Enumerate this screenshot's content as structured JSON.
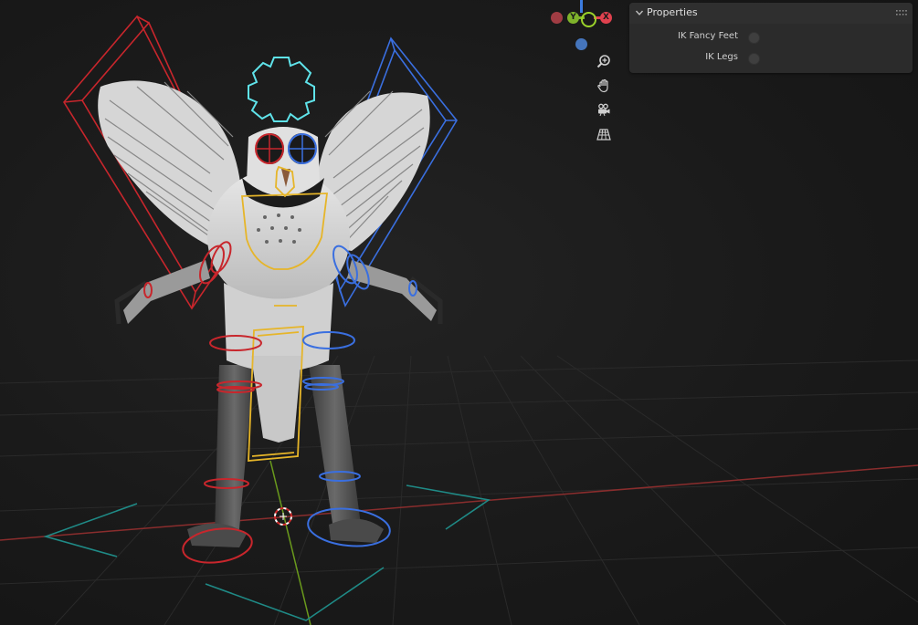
{
  "gizmo": {
    "x_label": "X",
    "y_label": "Y",
    "colors": {
      "x": "#e0414e",
      "y": "#7fb32b",
      "z": "#4a7fce"
    }
  },
  "nav_tools": [
    {
      "icon": "zoom-icon"
    },
    {
      "icon": "hand-pan-icon"
    },
    {
      "icon": "camera-icon"
    },
    {
      "icon": "perspective-grid-icon"
    }
  ],
  "properties_panel": {
    "title": "Properties",
    "rows": [
      {
        "label": "IK Fancy Feet",
        "checked": false
      },
      {
        "label": "IK Legs",
        "checked": false
      }
    ]
  },
  "scene": {
    "colors": {
      "left_rig": "#c8262c",
      "right_rig": "#3a6fe0",
      "center_rig": "#e6b529",
      "gear": "#5fe3ea",
      "grid_x_axis": "#8a2d2d",
      "grid_y_axis": "#6a9a1c",
      "ground_controls": "#1f8a86"
    }
  }
}
